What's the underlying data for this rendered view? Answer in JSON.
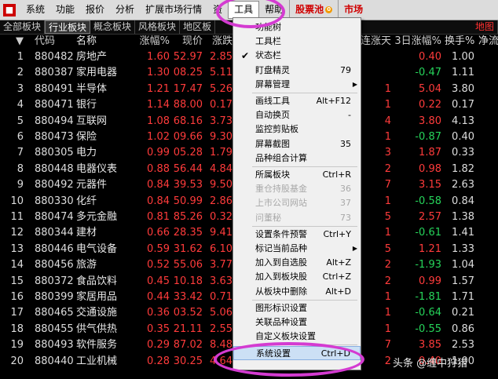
{
  "menubar": {
    "items": [
      "系统",
      "功能",
      "报价",
      "分析",
      "扩展市场行情",
      "资",
      "工具",
      "帮助"
    ],
    "red_items": [
      "股票池",
      "市场"
    ],
    "pool_badge": "0"
  },
  "tabs": [
    "全部板块",
    "行业板块",
    "概念板块",
    "风格板块",
    "地区板",
    "地图"
  ],
  "header": {
    "code": "代码",
    "name": "名称",
    "pct": "涨幅%",
    "price": "现价",
    "chg": "涨跌",
    "days": "连涨天",
    "three": "3日涨幅%",
    "turn": "换手%",
    "net": "净流"
  },
  "rows": [
    {
      "idx": "1",
      "code": "880482",
      "name": "房地产",
      "pct": "1.60",
      "price": "52.97",
      "chg": "2.85",
      "days": "",
      "three": "0.40",
      "three_dir": "up",
      "turn": "1.00"
    },
    {
      "idx": "2",
      "code": "880387",
      "name": "家用电器",
      "pct": "1.30",
      "price": "08.25",
      "chg": "5.11",
      "days": "",
      "three": "-0.47",
      "three_dir": "down",
      "turn": "1.11"
    },
    {
      "idx": "3",
      "code": "880491",
      "name": "半导体",
      "pct": "1.21",
      "price": "17.47",
      "chg": "5.26",
      "days": "1",
      "three": "5.04",
      "three_dir": "up",
      "turn": "3.80"
    },
    {
      "idx": "4",
      "code": "880471",
      "name": "银行",
      "pct": "1.14",
      "price": "88.00",
      "chg": "0.17",
      "days": "1",
      "three": "0.22",
      "three_dir": "up",
      "turn": "0.17"
    },
    {
      "idx": "5",
      "code": "880494",
      "name": "互联网",
      "pct": "1.08",
      "price": "68.16",
      "chg": "3.73",
      "days": "4",
      "three": "3.80",
      "three_dir": "up",
      "turn": "4.13"
    },
    {
      "idx": "6",
      "code": "880473",
      "name": "保险",
      "pct": "1.02",
      "price": "09.66",
      "chg": "9.30",
      "days": "1",
      "three": "-0.87",
      "three_dir": "down",
      "turn": "0.40"
    },
    {
      "idx": "7",
      "code": "880305",
      "name": "电力",
      "pct": "0.99",
      "price": "05.28",
      "chg": "1.79",
      "days": "3",
      "three": "1.87",
      "three_dir": "up",
      "turn": "0.33"
    },
    {
      "idx": "8",
      "code": "880448",
      "name": "电器仪表",
      "pct": "0.88",
      "price": "56.44",
      "chg": "4.84",
      "days": "2",
      "three": "0.98",
      "three_dir": "up",
      "turn": "1.82"
    },
    {
      "idx": "9",
      "code": "880492",
      "name": "元器件",
      "pct": "0.84",
      "price": "39.53",
      "chg": "9.50",
      "days": "7",
      "three": "3.15",
      "three_dir": "up",
      "turn": "2.63"
    },
    {
      "idx": "10",
      "code": "880330",
      "name": "化纤",
      "pct": "0.84",
      "price": "50.99",
      "chg": "2.86",
      "days": "1",
      "three": "-0.58",
      "three_dir": "down",
      "turn": "0.84"
    },
    {
      "idx": "11",
      "code": "880474",
      "name": "多元金融",
      "pct": "0.81",
      "price": "85.26",
      "chg": "0.32",
      "days": "5",
      "three": "2.57",
      "three_dir": "up",
      "turn": "1.38"
    },
    {
      "idx": "12",
      "code": "880344",
      "name": "建材",
      "pct": "0.66",
      "price": "28.35",
      "chg": "9.41",
      "days": "1",
      "three": "-0.61",
      "three_dir": "down",
      "turn": "1.41"
    },
    {
      "idx": "13",
      "code": "880446",
      "name": "电气设备",
      "pct": "0.59",
      "price": "31.62",
      "chg": "6.10",
      "days": "5",
      "three": "1.21",
      "three_dir": "up",
      "turn": "1.33"
    },
    {
      "idx": "14",
      "code": "880456",
      "name": "旅游",
      "pct": "0.52",
      "price": "55.06",
      "chg": "3.77",
      "days": "2",
      "three": "-1.93",
      "three_dir": "down",
      "turn": "1.04"
    },
    {
      "idx": "15",
      "code": "880372",
      "name": "食品饮料",
      "pct": "0.45",
      "price": "10.18",
      "chg": "3.63",
      "days": "2",
      "three": "0.99",
      "three_dir": "up",
      "turn": "1.57"
    },
    {
      "idx": "16",
      "code": "880399",
      "name": "家居用品",
      "pct": "0.44",
      "price": "33.42",
      "chg": "0.71",
      "days": "1",
      "three": "-1.81",
      "three_dir": "down",
      "turn": "1.71"
    },
    {
      "idx": "17",
      "code": "880465",
      "name": "交通设施",
      "pct": "0.36",
      "price": "03.52",
      "chg": "5.06",
      "days": "1",
      "three": "-0.64",
      "three_dir": "down",
      "turn": "0.21"
    },
    {
      "idx": "18",
      "code": "880455",
      "name": "供气供热",
      "pct": "0.35",
      "price": "21.11",
      "chg": "2.55",
      "days": "1",
      "three": "-0.55",
      "three_dir": "down",
      "turn": "0.86"
    },
    {
      "idx": "19",
      "code": "880493",
      "name": "软件服务",
      "pct": "0.29",
      "price": "87.02",
      "chg": "8.48",
      "days": "7",
      "three": "3.85",
      "three_dir": "up",
      "turn": "2.53"
    },
    {
      "idx": "20",
      "code": "880440",
      "name": "工业机械",
      "pct": "0.28",
      "price": "30.25",
      "chg": "4.64",
      "days": "2",
      "three": "0.40",
      "three_dir": "up",
      "turn": "1.00"
    }
  ],
  "menu": {
    "items": [
      {
        "label": "功能树",
        "acc": "",
        "disabled": false,
        "checked": false,
        "submenu": false
      },
      {
        "label": "工具栏",
        "acc": "",
        "disabled": false,
        "checked": false,
        "submenu": false
      },
      {
        "label": "状态栏",
        "acc": "",
        "disabled": false,
        "checked": true,
        "submenu": false
      },
      {
        "label": "盯盘精灵",
        "acc": "79",
        "disabled": false,
        "checked": false,
        "submenu": false
      },
      {
        "label": "屏幕管理",
        "acc": "",
        "disabled": false,
        "checked": false,
        "submenu": true
      },
      {
        "label": "画线工具",
        "acc": "Alt+F12",
        "disabled": false,
        "checked": false,
        "submenu": false
      },
      {
        "label": "自动换页",
        "acc": "-",
        "disabled": false,
        "checked": false,
        "submenu": false
      },
      {
        "label": "监控剪贴板",
        "acc": "",
        "disabled": false,
        "checked": false,
        "submenu": false
      },
      {
        "label": "屏幕截图",
        "acc": "35",
        "disabled": false,
        "checked": false,
        "submenu": false
      },
      {
        "label": "品种组合计算",
        "acc": "",
        "disabled": false,
        "checked": false,
        "submenu": false
      },
      {
        "label": "所属板块",
        "acc": "Ctrl+R",
        "disabled": false,
        "checked": false,
        "submenu": false
      },
      {
        "label": "重仓持股基金",
        "acc": "36",
        "disabled": true,
        "checked": false,
        "submenu": false
      },
      {
        "label": "上市公司网站",
        "acc": "37",
        "disabled": true,
        "checked": false,
        "submenu": false
      },
      {
        "label": "问董秘",
        "acc": "73",
        "disabled": true,
        "checked": false,
        "submenu": false
      },
      {
        "label": "设置条件预警",
        "acc": "Ctrl+Y",
        "disabled": false,
        "checked": false,
        "submenu": false
      },
      {
        "label": "标记当前品种",
        "acc": "",
        "disabled": false,
        "checked": false,
        "submenu": true
      },
      {
        "label": "加入到自选股",
        "acc": "Alt+Z",
        "disabled": false,
        "checked": false,
        "submenu": false
      },
      {
        "label": "加入到板块股",
        "acc": "Ctrl+Z",
        "disabled": false,
        "checked": false,
        "submenu": false
      },
      {
        "label": "从板块中删除",
        "acc": "Alt+D",
        "disabled": false,
        "checked": false,
        "submenu": false
      },
      {
        "label": "图形标识设置",
        "acc": "",
        "disabled": false,
        "checked": false,
        "submenu": false
      },
      {
        "label": "关联品种设置",
        "acc": "",
        "disabled": false,
        "checked": false,
        "submenu": false
      },
      {
        "label": "自定义板块设置",
        "acc": "",
        "disabled": false,
        "checked": false,
        "submenu": false
      },
      {
        "label": "系统设置",
        "acc": "Ctrl+D",
        "disabled": false,
        "checked": false,
        "submenu": false,
        "highlighted": true
      }
    ]
  },
  "watermark": "头条 @缠中狩猎"
}
